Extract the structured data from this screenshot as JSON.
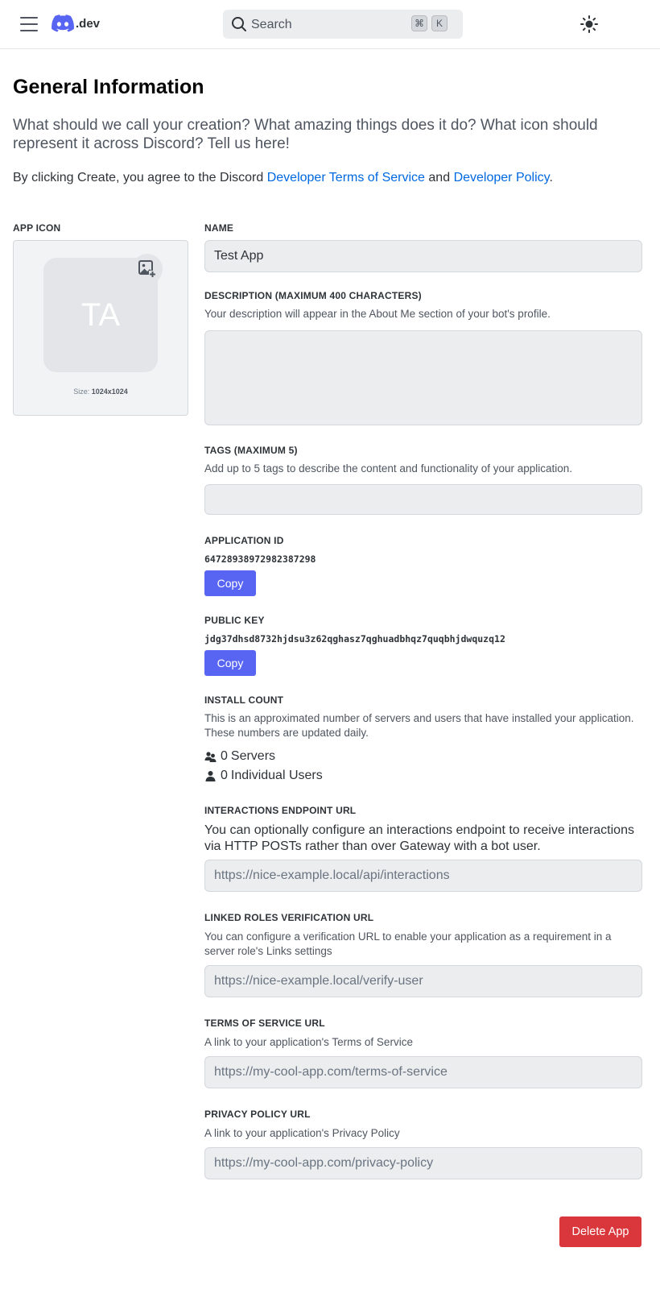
{
  "header": {
    "logo_text": ".dev",
    "search": {
      "placeholder": "Search",
      "shortcut_modifier": "⌘",
      "shortcut_key": "K"
    }
  },
  "page": {
    "title": "General Information",
    "intro": "What should we call your creation? What amazing things does it do? What icon should represent it across Discord? Tell us here!",
    "agree_prefix": "By clicking Create, you agree to the Discord",
    "terms_link": "Developer Terms of Service",
    "agree_and": "and",
    "policy_link": "Developer Policy",
    "agree_suffix": "."
  },
  "app_icon": {
    "label": "APP ICON",
    "initials": "TA",
    "size_label": "Size:",
    "size_value": "1024x1024"
  },
  "name": {
    "label": "NAME",
    "value": "Test App"
  },
  "description": {
    "label": "DESCRIPTION (MAXIMUM 400 CHARACTERS)",
    "help": "Your description will appear in the About Me section of your bot's profile.",
    "value": ""
  },
  "tags": {
    "label": "TAGS (MAXIMUM 5)",
    "help": "Add up to 5 tags to describe the content and functionality of your application.",
    "value": ""
  },
  "application_id": {
    "label": "APPLICATION ID",
    "value": "64728938972982387298",
    "copy_label": "Copy"
  },
  "public_key": {
    "label": "PUBLIC KEY",
    "value": "jdg37dhsd8732hjdsu3z62qghasz7qghuadbhqz7quqbhjdwquzq12",
    "copy_label": "Copy"
  },
  "install_count": {
    "label": "INSTALL COUNT",
    "help": "This is an approximated number of servers and users that have installed your application. These numbers are updated daily.",
    "servers_count": "0",
    "servers_label": "Servers",
    "users_count": "0",
    "users_label": "Individual Users"
  },
  "interactions_endpoint": {
    "label": "INTERACTIONS ENDPOINT URL",
    "help": "You can optionally configure an interactions endpoint to receive interactions via HTTP POSTs rather than over Gateway with a bot user.",
    "placeholder": "https://nice-example.local/api/interactions"
  },
  "linked_roles": {
    "label": "LINKED ROLES VERIFICATION URL",
    "help": "You can configure a verification URL to enable your application as a requirement in a server role's Links settings",
    "placeholder": "https://nice-example.local/verify-user"
  },
  "terms_of_service": {
    "label": "TERMS OF SERVICE URL",
    "help": "A link to your application's Terms of Service",
    "placeholder": "https://my-cool-app.com/terms-of-service"
  },
  "privacy_policy": {
    "label": "PRIVACY POLICY URL",
    "help": "A link to your application's Privacy Policy",
    "placeholder": "https://my-cool-app.com/privacy-policy"
  },
  "actions": {
    "delete_label": "Delete App"
  },
  "colors": {
    "blurple": "#5865f2",
    "danger": "#da373c",
    "link": "#0068e0"
  }
}
